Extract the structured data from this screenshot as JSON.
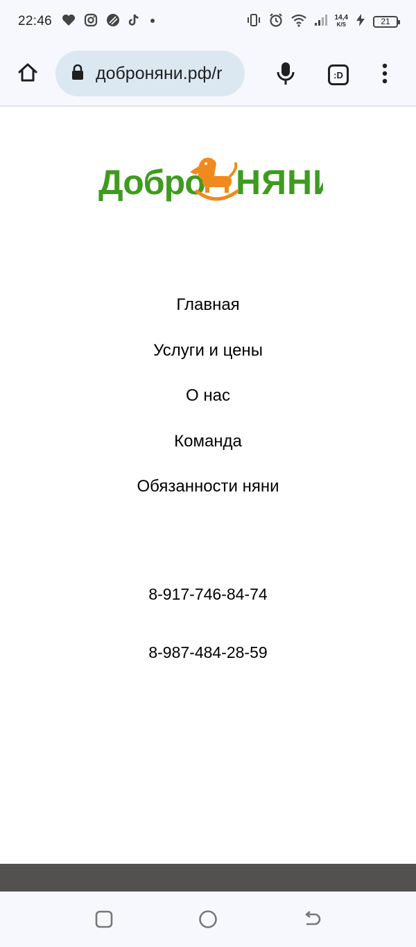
{
  "status_bar": {
    "time": "22:46",
    "left_icons": [
      "heart-icon",
      "instagram-icon",
      "app-icon",
      "tiktok-icon",
      "dot-icon"
    ],
    "right_icons": [
      "vibrate-icon",
      "alarm-icon",
      "wifi-icon",
      "signal-icon",
      "charging-icon"
    ],
    "net_speed_value": "14,4",
    "net_speed_unit": "K/S",
    "battery": "21"
  },
  "browser": {
    "url": "доброняни.рф/r",
    "tab_label": ":D",
    "icons": {
      "home": "home-icon",
      "lock": "lock-icon",
      "mic": "mic-icon",
      "menu": "more-vert-icon"
    }
  },
  "logo": {
    "colors": {
      "green": "#3f9b1f",
      "orange": "#f08a1c"
    }
  },
  "nav": {
    "items": [
      {
        "label": "Главная"
      },
      {
        "label": "Услуги и цены"
      },
      {
        "label": "О нас"
      },
      {
        "label": "Команда"
      },
      {
        "label": "Обязанности няни"
      }
    ]
  },
  "contacts": {
    "phones": [
      "8-917-746-84-74",
      "8-987-484-28-59"
    ]
  },
  "system_nav": {
    "icons": [
      "recents-icon",
      "home-circle-icon",
      "back-icon"
    ]
  },
  "colors": {
    "chrome_bg": "#f7f8fd",
    "url_pill_bg": "#dce8f1",
    "footer_bar": "#535150"
  }
}
